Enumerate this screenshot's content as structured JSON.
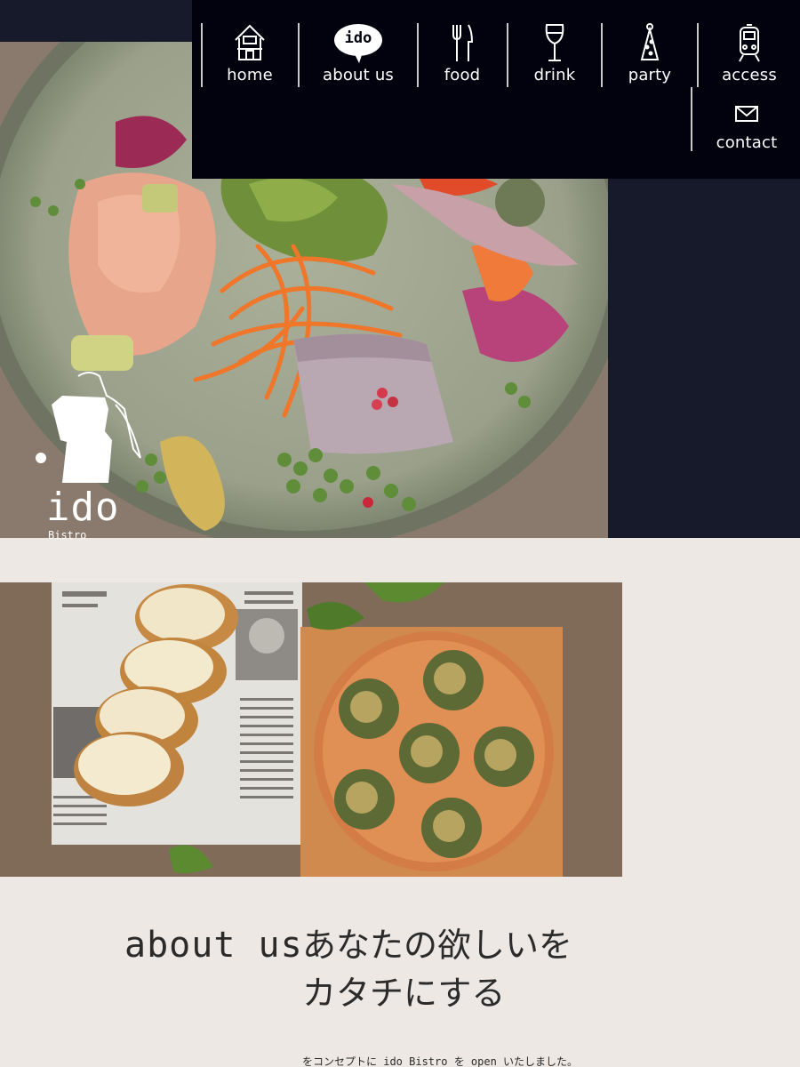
{
  "nav": {
    "items": [
      {
        "label": "home",
        "icon": "house-icon"
      },
      {
        "label": "about us",
        "icon": "speech-bubble-icon",
        "bubble_text": "ido"
      },
      {
        "label": "food",
        "icon": "fork-knife-icon"
      },
      {
        "label": "drink",
        "icon": "wine-glass-icon"
      },
      {
        "label": "party",
        "icon": "party-hat-icon"
      },
      {
        "label": "access",
        "icon": "train-icon"
      },
      {
        "label": "contact",
        "icon": "envelope-icon"
      }
    ]
  },
  "logo": {
    "text": "ido",
    "subtext": "Bistro"
  },
  "about": {
    "heading": "about us",
    "title_line1": "あなたの欲しいを",
    "title_line2": "カタチにする",
    "text": "をコンセプトに ido Bistro を open いたしました。"
  },
  "colors": {
    "nav_bg": "#02020f",
    "band_bg": "#161a2b",
    "page_bg": "#ede8e3",
    "text": "#2b2b2b"
  }
}
